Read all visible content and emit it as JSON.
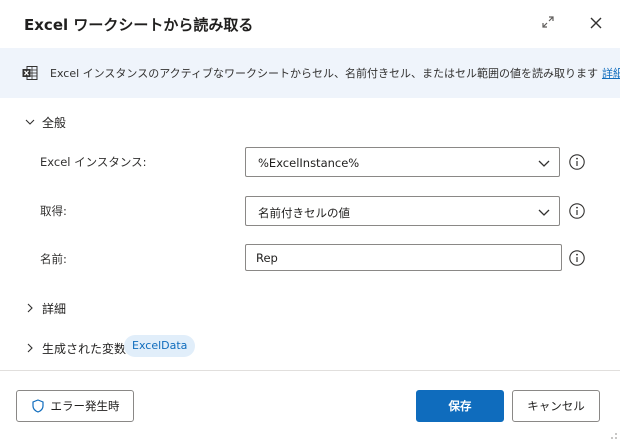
{
  "dialog": {
    "title": "Excel ワークシートから読み取る",
    "description": "Excel インスタンスのアクティブなワークシートからセル、名前付きセル、またはセル範囲の値を読み取ります",
    "details_link": "詳細"
  },
  "general": {
    "header": "全般",
    "fields": [
      {
        "label": "Excel インスタンス:",
        "value": "%ExcelInstance%",
        "type": "select"
      },
      {
        "label": "取得:",
        "value": "名前付きセルの値",
        "type": "select"
      },
      {
        "label": "名前:",
        "value": "Rep",
        "type": "text"
      }
    ]
  },
  "advanced": {
    "header": "詳細"
  },
  "variables": {
    "header": "生成された変数",
    "badge": "ExcelData"
  },
  "footer": {
    "on_error_label": "エラー発生時",
    "save_label": "保存",
    "cancel_label": "キャンセル"
  },
  "icons": {
    "expand": "expand-icon",
    "close": "close-icon",
    "excel": "excel-icon",
    "help": "info-circle-icon",
    "shield": "shield-icon",
    "chevron": "chevron-icon"
  },
  "colors": {
    "accent": "#0f6cbd",
    "info_bar_bg": "#eff4fb",
    "badge_bg": "#e1eefa"
  }
}
